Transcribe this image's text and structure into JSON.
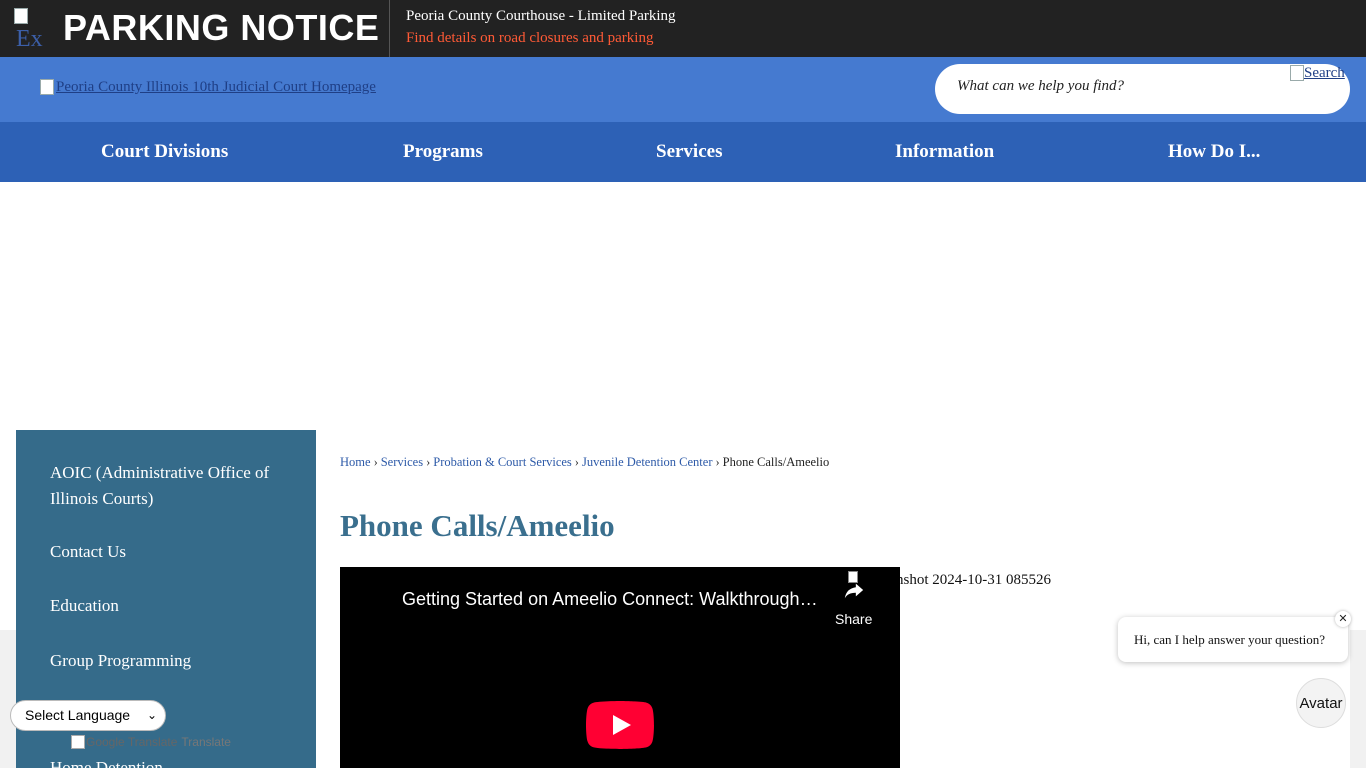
{
  "alert": {
    "icon_alt": "Ex",
    "title": "PARKING NOTICE",
    "headline": "Peoria County Courthouse - Limited Parking",
    "link_text": "Find details on road closures and parking"
  },
  "header": {
    "logo_alt": "Peoria County Illinois 10th Judicial Court Homepage",
    "search_placeholder": "What can we help you find?",
    "search_button_alt": "Search"
  },
  "nav": {
    "items": [
      "Court Divisions",
      "Programs",
      "Services",
      "Information",
      "How Do I..."
    ]
  },
  "sidebar": {
    "items": [
      "AOIC (Administrative Office of Illinois Courts)",
      "Contact Us",
      "Education",
      "Group Programming"
    ],
    "partial_item": "Home Detention"
  },
  "breadcrumb": {
    "items": [
      "Home",
      "Services",
      "Probation & Court Services",
      "Juvenile Detention Center"
    ],
    "current": "Phone Calls/Ameelio",
    "separator": "›"
  },
  "page": {
    "title": "Phone Calls/Ameelio",
    "image_caption": "nshot 2024-10-31 085526"
  },
  "video": {
    "title": "Getting Started on Ameelio Connect: Walkthrough for Families",
    "share_label": "Share"
  },
  "translate": {
    "select_label": "Select Language",
    "powered_by_alt": "Google Translate",
    "translate_word": "Translate"
  },
  "chat": {
    "message": "Hi, can I help answer your question?",
    "close": "✕",
    "avatar_alt": "Avatar"
  },
  "colors": {
    "alert_bg": "#222222",
    "alert_link": "#ff5a36",
    "header_bg": "#457ad0",
    "nav_bg": "#2d61b6",
    "sidebar_bg": "#356b8a",
    "title_color": "#3a6f8e",
    "youtube_red": "#ff0033"
  }
}
